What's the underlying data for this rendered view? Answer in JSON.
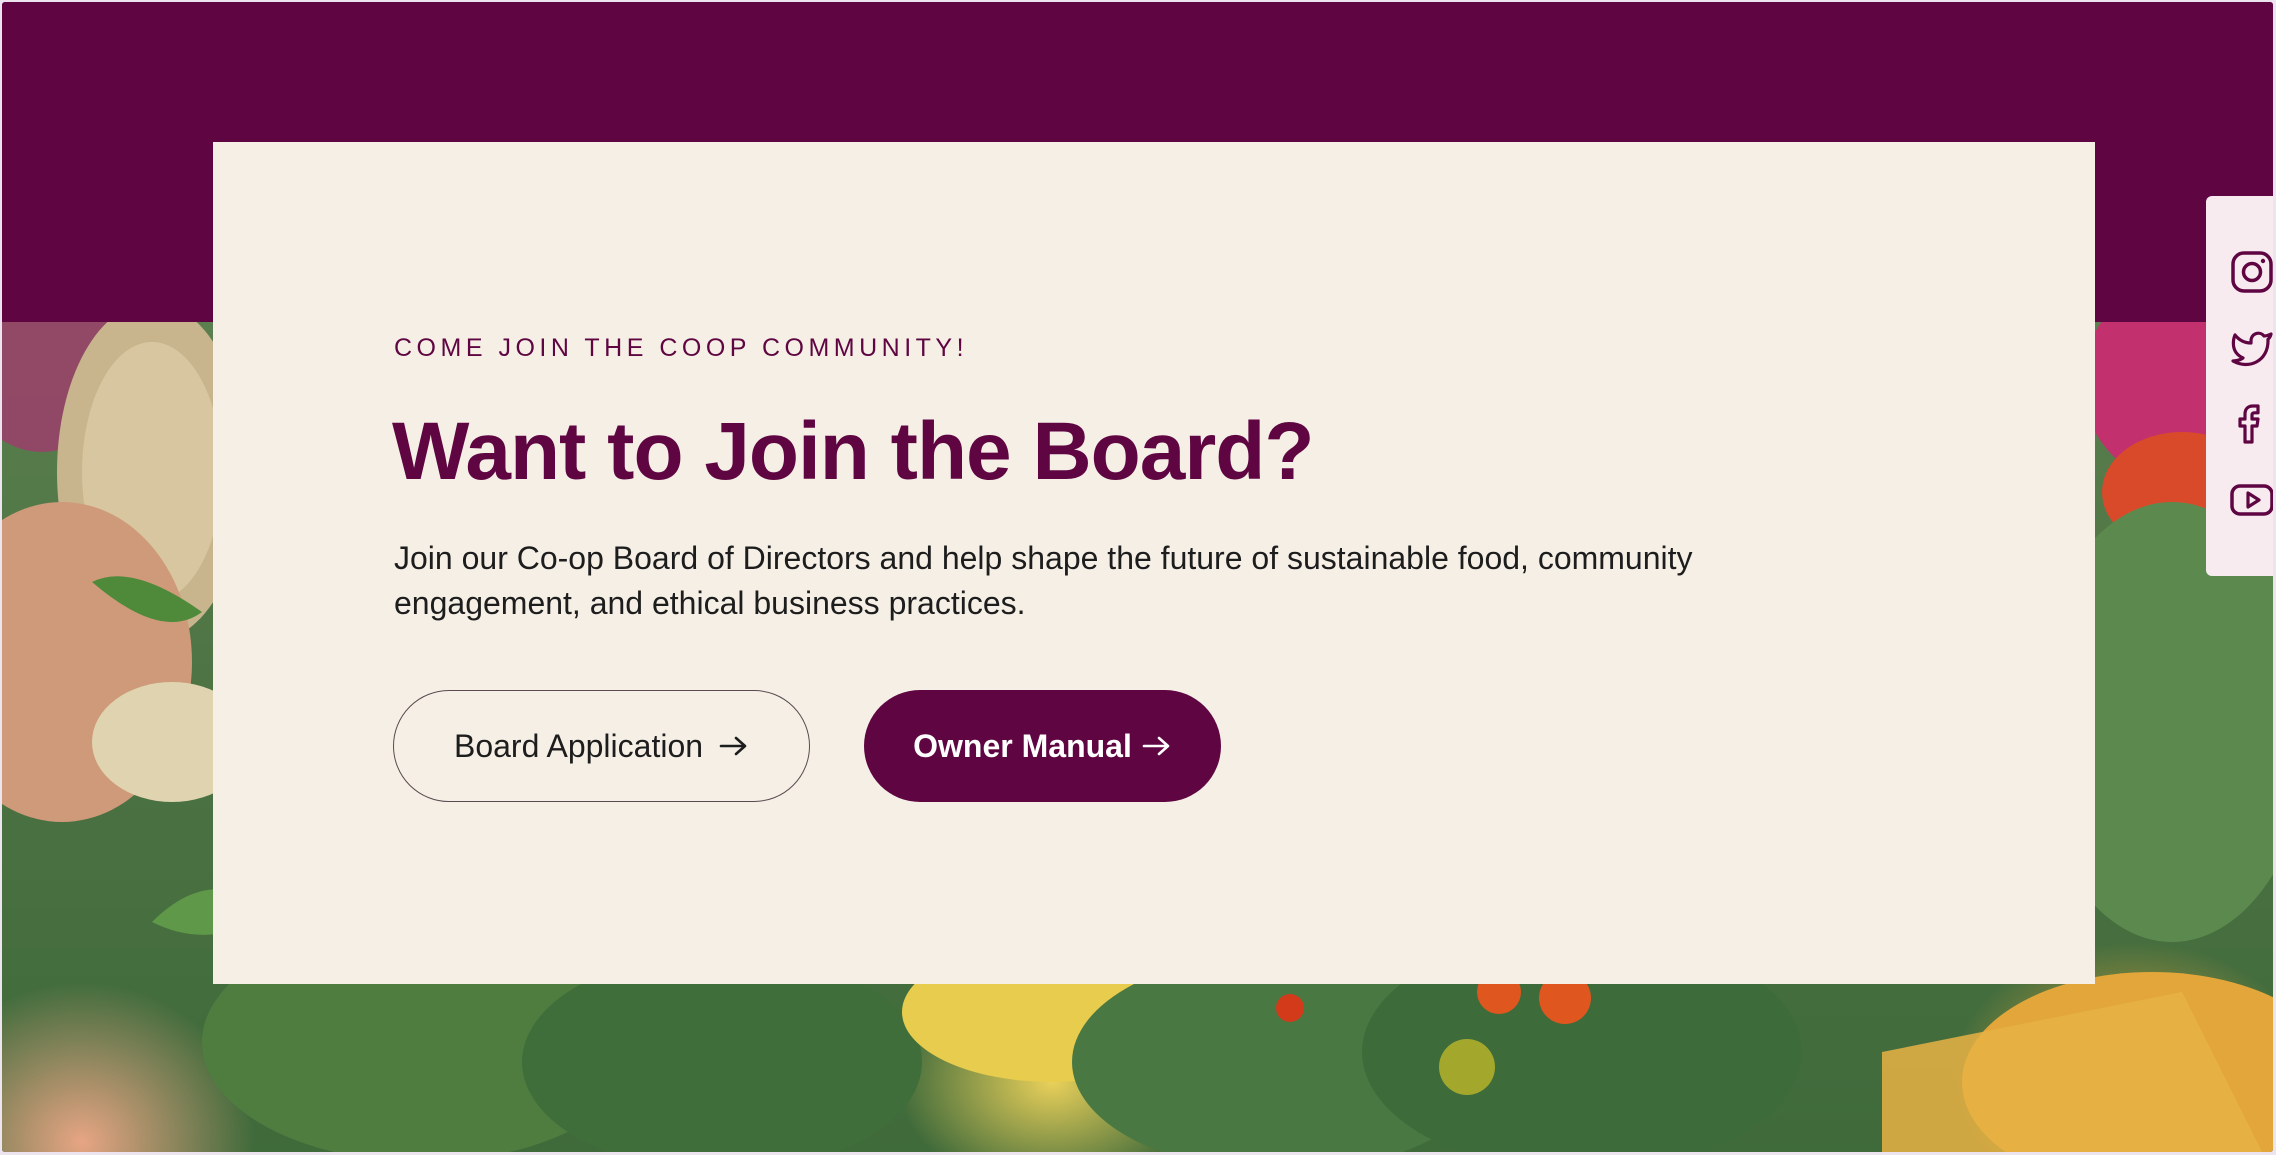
{
  "section": {
    "eyebrow": "COME JOIN THE COOP COMMUNITY!",
    "title": "Want to Join the Board?",
    "description": "Join our Co-op Board of Directors and help shape the future of sustainable food, community engagement, and ethical business practices."
  },
  "buttons": {
    "board_application": {
      "label": "Board Application",
      "icon": "arrow-right-icon"
    },
    "owner_manual": {
      "label": "Owner Manual",
      "icon": "arrow-right-icon"
    }
  },
  "social": [
    "instagram-icon",
    "twitter-icon",
    "facebook-icon",
    "youtube-icon"
  ],
  "colors": {
    "brand_plum": "#5f0642",
    "card_cream": "#f5efe6",
    "social_bar": "#f8ebf0",
    "text_dark": "#1d1d1d"
  },
  "background_image": "produce-photo"
}
